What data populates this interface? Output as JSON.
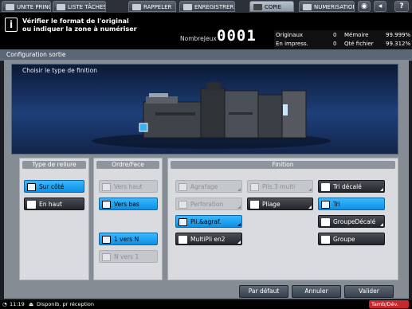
{
  "tabs": [
    {
      "label": "UNITE PRINC.",
      "icon": "machine-icon"
    },
    {
      "label": "LISTE TÂCHES",
      "icon": "list-icon"
    },
    {
      "label": "RAPPELER",
      "icon": "recall-icon"
    },
    {
      "label": "ENREGISTRER",
      "icon": "save-icon"
    },
    {
      "label": "COPIE",
      "icon": "copy-icon",
      "active": true
    },
    {
      "label": "NUMERISATION",
      "icon": "scan-icon"
    }
  ],
  "message": {
    "line1": "Vérifier le format de l'original",
    "line2": "ou indiquer la zone à numériser"
  },
  "counter": {
    "label": "NombreJeux",
    "value": "0001"
  },
  "stats": {
    "originaux_label": "Originaux",
    "originaux": "0",
    "memoire_label": "Mémoire",
    "memoire": "99.999%",
    "impress_label": "En impress.",
    "impress": "0",
    "qte_label": "Qté fichier",
    "qte": "99.312%"
  },
  "header": "Configuration sortie",
  "preview_title": "Choisir le type de finition",
  "reliure": {
    "title": "Type de reliure",
    "cote": "Sur côté",
    "haut": "En haut"
  },
  "ordre": {
    "title": "Ordre/Face",
    "vers_haut": "Vers haut",
    "vers_bas": "Vers bas",
    "un_vers_n": "1 vers N",
    "n_vers_1": "N vers 1"
  },
  "finition": {
    "title": "Finition",
    "agrafage": "Agrafage",
    "plis3": "Plis.3 multi",
    "tri_decale": "Tri décalé",
    "perforation": "Perforation",
    "pliage": "Pliage",
    "tri": "Tri",
    "pli_agraf": "Pli.&agraf.",
    "groupe_decale": "GroupeDécalé",
    "multipli": "MultiPli en2",
    "groupe": "Groupe"
  },
  "actions": {
    "defaut": "Par défaut",
    "annuler": "Annuler",
    "valider": "Valider"
  },
  "status": {
    "time": "11:19",
    "reception": "Disponib. pr réception",
    "right": "Tamb/Dév."
  },
  "colors": {
    "selected": "#1e9ef0",
    "accent_red": "#c8282d"
  }
}
